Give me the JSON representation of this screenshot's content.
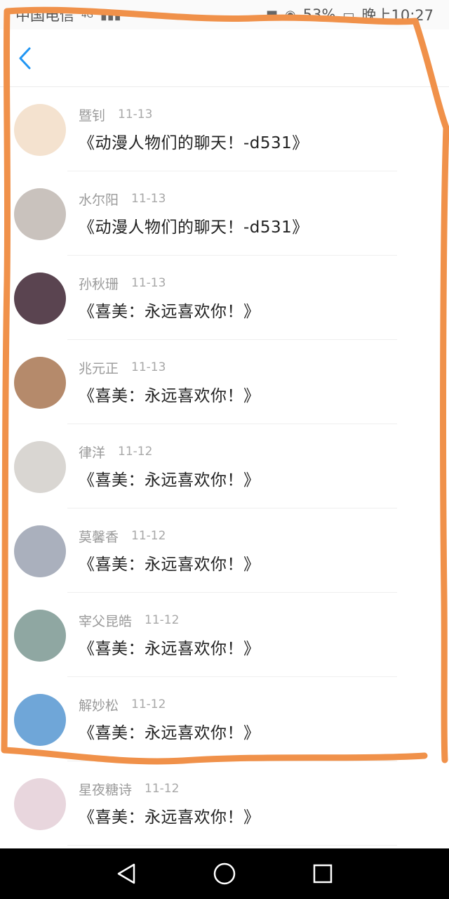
{
  "status_bar": {
    "carrier": "中国电信",
    "signal": "4G",
    "battery": "53%",
    "time": "晚上10:27"
  },
  "header": {
    "back_icon": "chevron-left-icon",
    "accent": "#2196f3"
  },
  "messages": [
    {
      "sender": "暨钊",
      "date": "11-13",
      "subject": "《动漫人物们的聊天！-d531》",
      "avatar_color": "#f4e2cf"
    },
    {
      "sender": "水尔阳",
      "date": "11-13",
      "subject": "《动漫人物们的聊天！-d531》",
      "avatar_color": "#c9c2bd"
    },
    {
      "sender": "孙秋珊",
      "date": "11-13",
      "subject": "《喜美：永远喜欢你！》",
      "avatar_color": "#5a4450"
    },
    {
      "sender": "兆元正",
      "date": "11-13",
      "subject": "《喜美：永远喜欢你！》",
      "avatar_color": "#b58a6b"
    },
    {
      "sender": "律洋",
      "date": "11-12",
      "subject": "《喜美：永远喜欢你！》",
      "avatar_color": "#d9d6d2"
    },
    {
      "sender": "莫馨香",
      "date": "11-12",
      "subject": "《喜美：永远喜欢你！》",
      "avatar_color": "#aab0bd"
    },
    {
      "sender": "宰父昆皓",
      "date": "11-12",
      "subject": "《喜美：永远喜欢你！》",
      "avatar_color": "#8fa7a2"
    },
    {
      "sender": "解妙松",
      "date": "11-12",
      "subject": "《喜美：永远喜欢你！》",
      "avatar_color": "#6fa6d8"
    },
    {
      "sender": "星夜糖诗",
      "date": "11-12",
      "subject": "《喜美：永远喜欢你！》",
      "avatar_color": "#e8d6dd"
    }
  ],
  "annotation": {
    "color": "#f0914a"
  },
  "nav_bar": {
    "back_icon": "triangle-back-icon",
    "home_icon": "circle-home-icon",
    "recents_icon": "square-recents-icon"
  }
}
